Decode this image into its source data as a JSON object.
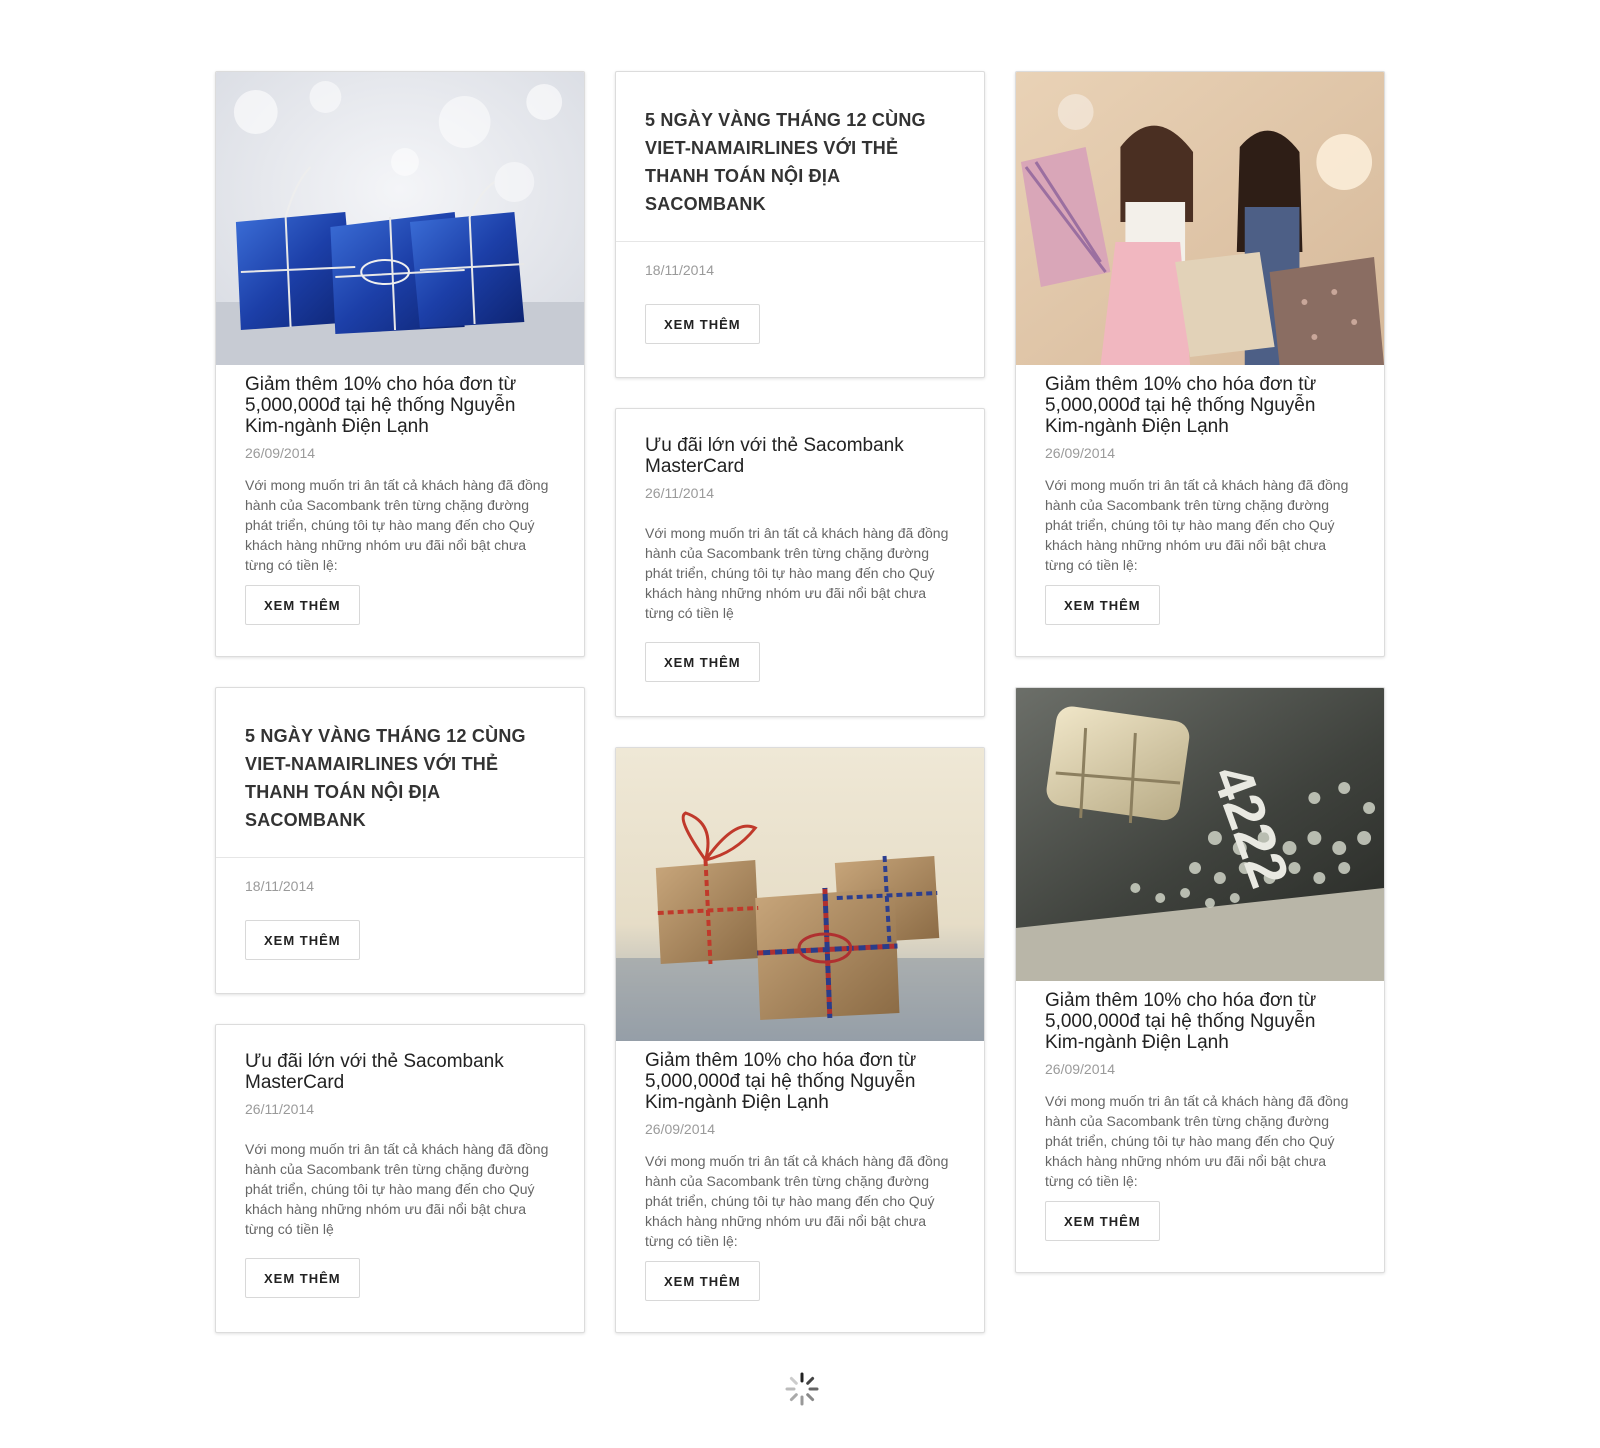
{
  "cards": [
    {
      "title": "Giảm thêm 10% cho hóa đơn từ 5,000,000đ tại hệ thống Nguyễn Kim-ngành Điện Lạnh",
      "date": "26/09/2014",
      "desc": "Với mong muốn tri ân tất cả khách hàng đã đồng hành của Sacombank trên từng chặng đường phát triển, chúng tôi tự hào mang đến cho Quý khách hàng những nhóm ưu đãi nổi bật chưa từng có tiền lệ:",
      "button": "XEM THÊM",
      "image": "blue-gift-boxes"
    },
    {
      "title": "5 NGÀY VÀNG THÁNG 12 CÙNG VIET-NAMAIRLINES VỚI THẺ THANH TOÁN NỘI ĐỊA SACOMBANK",
      "date": "18/11/2014",
      "button": "XEM THÊM"
    },
    {
      "title": "Giảm thêm 10% cho hóa đơn từ 5,000,000đ tại hệ thống Nguyễn Kim-ngành Điện Lạnh",
      "date": "26/09/2014",
      "desc": "Với mong muốn tri ân tất cả khách hàng đã đồng hành của Sacombank trên từng chặng đường phát triển, chúng tôi tự hào mang đến cho Quý khách hàng những nhóm ưu đãi nổi bật chưa từng có tiền lệ:",
      "button": "XEM THÊM",
      "image": "shopping-women"
    },
    {
      "title": "Ưu đãi lớn với thẻ Sacombank MasterCard",
      "date": "26/11/2014",
      "desc": "Với mong muốn tri ân tất cả khách hàng đã đồng hành của Sacombank trên từng chặng đường phát triển, chúng tôi tự hào mang đến cho Quý khách hàng những nhóm ưu đãi nổi bật chưa từng có tiền lệ",
      "button": "XEM THÊM"
    },
    {
      "title": "5 NGÀY VÀNG THÁNG 12 CÙNG VIET-NAMAIRLINES VỚI THẺ THANH TOÁN NỘI ĐỊA SACOMBANK",
      "date": "18/11/2014",
      "button": "XEM THÊM"
    },
    {
      "title": "Giảm thêm 10% cho hóa đơn từ 5,000,000đ tại hệ thống Nguyễn Kim-ngành Điện Lạnh",
      "date": "26/09/2014",
      "desc": "Với mong muốn tri ân tất cả khách hàng đã đồng hành của Sacombank trên từng chặng đường phát triển, chúng tôi tự hào mang đến cho Quý khách hàng những nhóm ưu đãi nổi bật chưa từng có tiền lệ:",
      "button": "XEM THÊM",
      "image": "kraft-gift-boxes"
    },
    {
      "title": "Giảm thêm 10% cho hóa đơn từ 5,000,000đ tại hệ thống Nguyễn Kim-ngành Điện Lạnh",
      "date": "26/09/2014",
      "desc": "Với mong muốn tri ân tất cả khách hàng đã đồng hành của Sacombank trên từng chặng đường phát triển, chúng tôi tự hào mang đến cho Quý khách hàng những nhóm ưu đãi nổi bật chưa từng có tiền lệ:",
      "button": "XEM THÊM",
      "image": "credit-card-chip",
      "card_digits": "4222"
    },
    {
      "title": "Ưu đãi lớn với thẻ Sacombank MasterCard",
      "date": "26/11/2014",
      "desc": "Với mong muốn tri ân tất cả khách hàng đã đồng hành của Sacombank trên từng chặng đường phát triển, chúng tôi tự hào mang đến cho Quý khách hàng những nhóm ưu đãi nổi bật chưa từng có tiền lệ",
      "button": "XEM THÊM"
    }
  ],
  "loader": "loading-spinner-icon"
}
